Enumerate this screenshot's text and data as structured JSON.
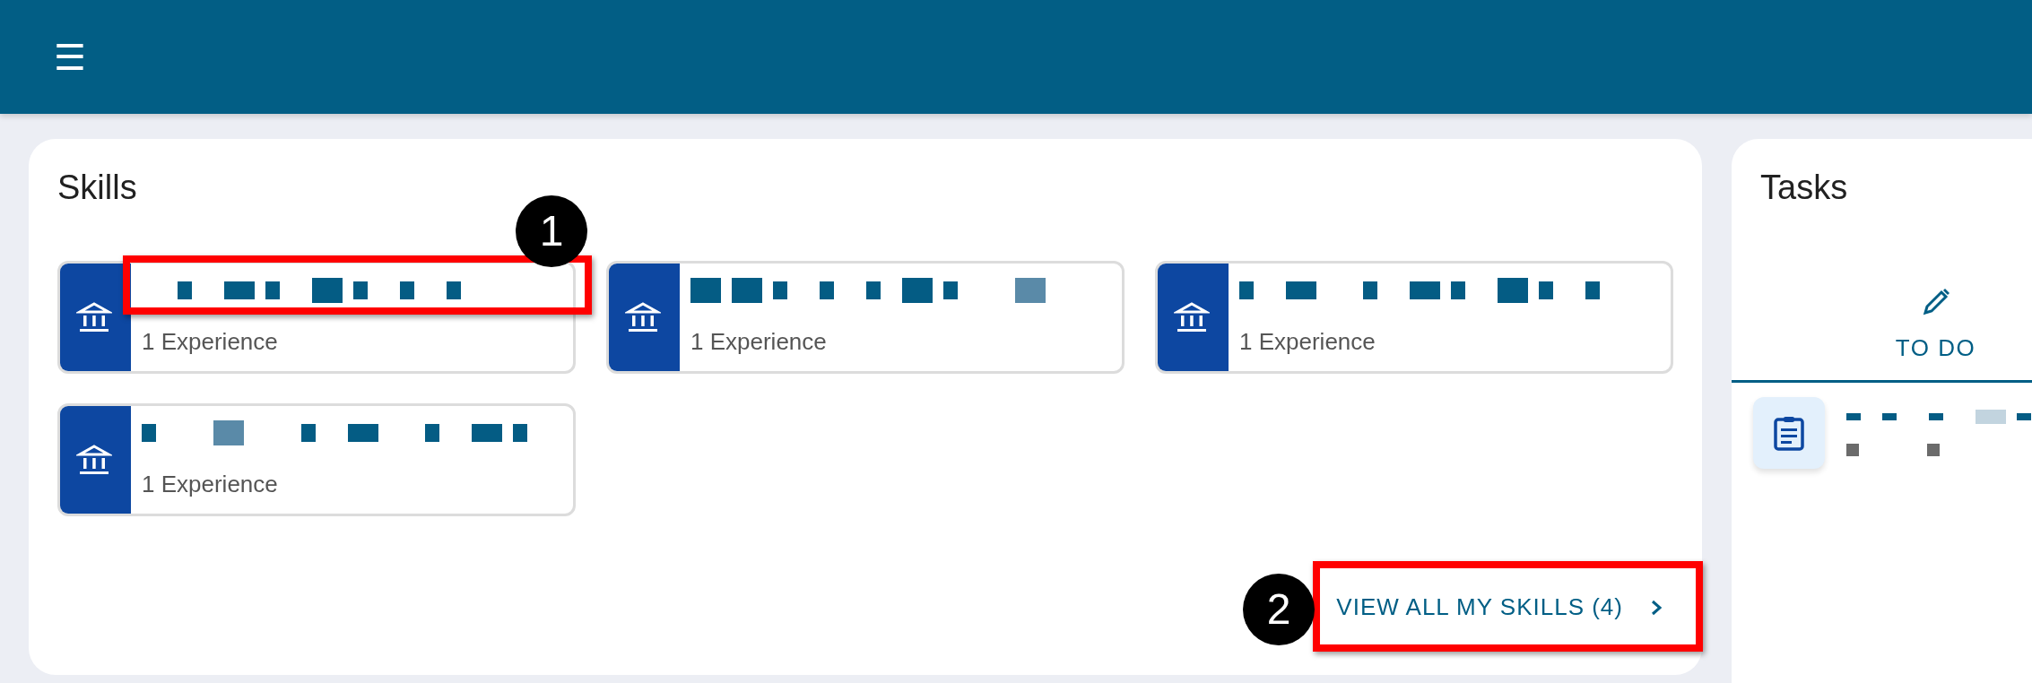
{
  "header": {
    "menu_button": "☰"
  },
  "skills": {
    "title": "Skills",
    "cards": [
      {
        "experience": "1 Experience",
        "highlighted": true
      },
      {
        "experience": "1 Experience",
        "highlighted": false
      },
      {
        "experience": "1 Experience",
        "highlighted": false
      },
      {
        "experience": "1 Experience",
        "highlighted": false
      }
    ],
    "view_all": {
      "label": "VIEW ALL MY SKILLS (4)",
      "highlighted": true
    }
  },
  "tasks": {
    "title": "Tasks",
    "tabs": [
      {
        "label": "TO DO",
        "selected": true
      }
    ],
    "items": [
      {
        "kind": "clipboard"
      }
    ]
  },
  "callouts": [
    {
      "number": "1"
    },
    {
      "number": "2"
    }
  ]
}
